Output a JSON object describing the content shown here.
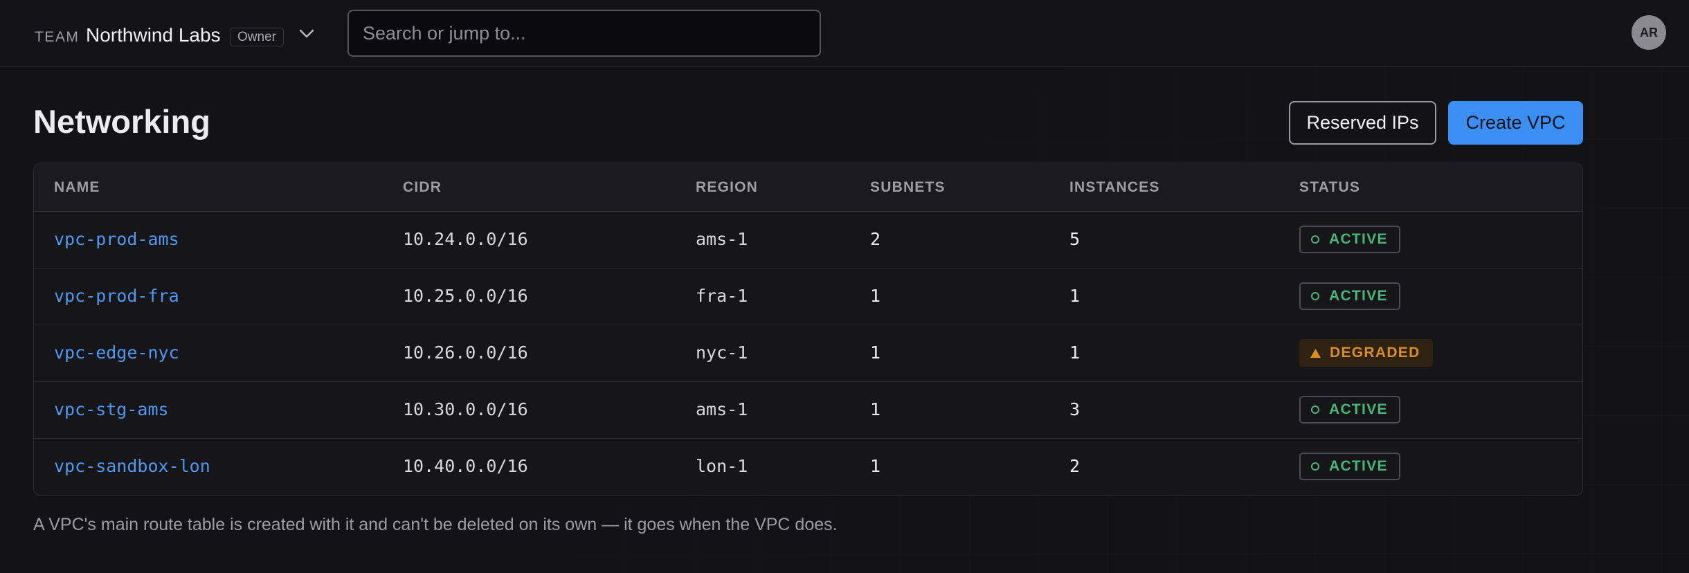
{
  "topbar": {
    "team_label": "TEAM",
    "team_name": "Northwind Labs",
    "role_badge": "Owner",
    "search_placeholder": "Search or jump to...",
    "avatar_initials": "AR"
  },
  "header": {
    "title": "Networking",
    "secondary_button": "Reserved IPs",
    "primary_button": "Create VPC"
  },
  "table": {
    "columns": [
      "NAME",
      "CIDR",
      "REGION",
      "SUBNETS",
      "INSTANCES",
      "STATUS"
    ],
    "rows": [
      {
        "name": "vpc-prod-ams",
        "cidr": "10.24.0.0/16",
        "region": "ams-1",
        "subnets": "2",
        "instances": "5",
        "status": "ACTIVE"
      },
      {
        "name": "vpc-prod-fra",
        "cidr": "10.25.0.0/16",
        "region": "fra-1",
        "subnets": "1",
        "instances": "1",
        "status": "ACTIVE"
      },
      {
        "name": "vpc-edge-nyc",
        "cidr": "10.26.0.0/16",
        "region": "nyc-1",
        "subnets": "1",
        "instances": "1",
        "status": "DEGRADED"
      },
      {
        "name": "vpc-stg-ams",
        "cidr": "10.30.0.0/16",
        "region": "ams-1",
        "subnets": "1",
        "instances": "3",
        "status": "ACTIVE"
      },
      {
        "name": "vpc-sandbox-lon",
        "cidr": "10.40.0.0/16",
        "region": "lon-1",
        "subnets": "1",
        "instances": "2",
        "status": "ACTIVE"
      }
    ]
  },
  "footnote": "A VPC's main route table is created with it and can't be deleted on its own — it goes when the VPC does.",
  "colors": {
    "accent": "#3b8ff2",
    "link": "#4f97f0",
    "active": "#49b67e",
    "degraded": "#d98e1e",
    "background": "#131316"
  },
  "icons": {
    "active": "circle-outline-icon",
    "degraded": "warning-triangle-icon",
    "team_switcher": "chevron-down-icon"
  }
}
